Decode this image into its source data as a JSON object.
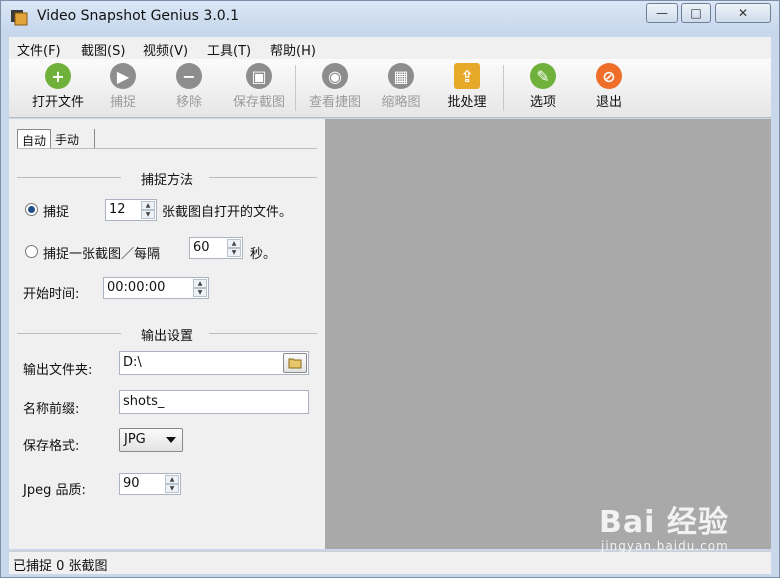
{
  "window": {
    "title": "Video Snapshot Genius 3.0.1",
    "controls": {
      "minimize": "—",
      "maximize": "□",
      "close": "✕"
    }
  },
  "menu": {
    "items": [
      "文件(F)",
      "截图(S)",
      "视频(V)",
      "工具(T)",
      "帮助(H)"
    ]
  },
  "toolbar": {
    "buttons": [
      {
        "label": "打开文件",
        "icon": "add-icon",
        "enabled": true,
        "color": "#6fb13b"
      },
      {
        "label": "捕捉",
        "icon": "play-icon",
        "enabled": false,
        "color": "#8d8d8d"
      },
      {
        "label": "移除",
        "icon": "minus-icon",
        "enabled": false,
        "color": "#8d8d8d"
      },
      {
        "label": "保存截图",
        "icon": "save-icon",
        "enabled": false,
        "color": "#8d8d8d"
      },
      {
        "label": "查看捷图",
        "icon": "view-icon",
        "enabled": false,
        "color": "#8d8d8d"
      },
      {
        "label": "缩略图",
        "icon": "thumbnail-icon",
        "enabled": false,
        "color": "#8d8d8d"
      },
      {
        "label": "批处理",
        "icon": "batch-icon",
        "enabled": true,
        "color": "#e6a92a"
      },
      {
        "label": "选项",
        "icon": "wrench-icon",
        "enabled": true,
        "color": "#6fb13b"
      },
      {
        "label": "退出",
        "icon": "exit-icon",
        "enabled": true,
        "color": "#ef6e2a"
      }
    ]
  },
  "tabs": [
    "自动",
    "手动"
  ],
  "capture": {
    "section_title": "捕捉方法",
    "option1_label": "捕捉",
    "option1_value": "12",
    "option1_suffix": "张截图自打开的文件。",
    "option2_label": "捕捉一张截图／每隔",
    "option2_value": "60",
    "option2_suffix": "秒。",
    "start_label": "开始时间:",
    "start_value": "00:00:00"
  },
  "output": {
    "section_title": "输出设置",
    "folder_label": "输出文件夹:",
    "folder_value": "D:\\",
    "prefix_label": "名称前缀:",
    "prefix_value": "shots_",
    "format_label": "保存格式:",
    "format_value": "JPG",
    "quality_label": "Jpeg 品质:",
    "quality_value": "90"
  },
  "status": {
    "text": "已捕捉 0 张截图"
  },
  "watermark": {
    "main": "Bai 经验",
    "sub": "jingyan.baidu.com"
  }
}
